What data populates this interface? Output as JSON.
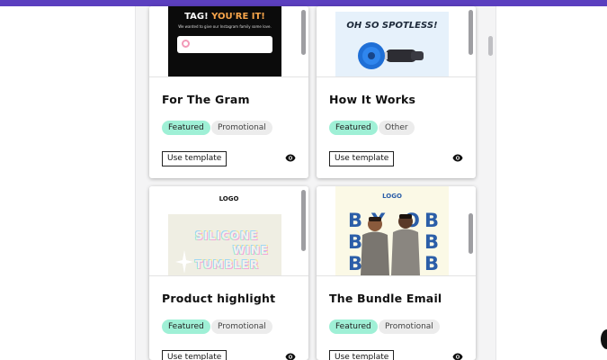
{
  "cards": [
    {
      "title": "For The Gram",
      "tags": [
        "Featured",
        "Promotional"
      ],
      "button": "Use template",
      "thumb": {
        "heading_a": "TAG! ",
        "heading_b": "YOU'RE IT!",
        "subtext": "We wanted to give our Instagram family some love."
      }
    },
    {
      "title": "How It Works",
      "tags": [
        "Featured",
        "Other"
      ],
      "button": "Use template",
      "thumb": {
        "heading": "OH SO SPOTLESS!"
      }
    },
    {
      "title": "Product highlight",
      "tags": [
        "Featured",
        "Promotional"
      ],
      "button": "Use template",
      "thumb": {
        "logo": "LOGO",
        "words": [
          "SILICONE",
          "WINE",
          "TUMBLER"
        ]
      }
    },
    {
      "title": "The Bundle Email",
      "tags": [
        "Featured",
        "Promotional"
      ],
      "button": "Use template",
      "thumb": {
        "logo": "LOGO",
        "letters": [
          "B",
          "Y",
          "O",
          "B",
          "B",
          "B",
          "B",
          "B"
        ]
      }
    }
  ],
  "icons": {
    "preview": "eye-icon"
  },
  "colors": {
    "topbar": "#5b3fbf",
    "featured_tag": "#9ff0d6",
    "other_tag": "#ececec"
  }
}
